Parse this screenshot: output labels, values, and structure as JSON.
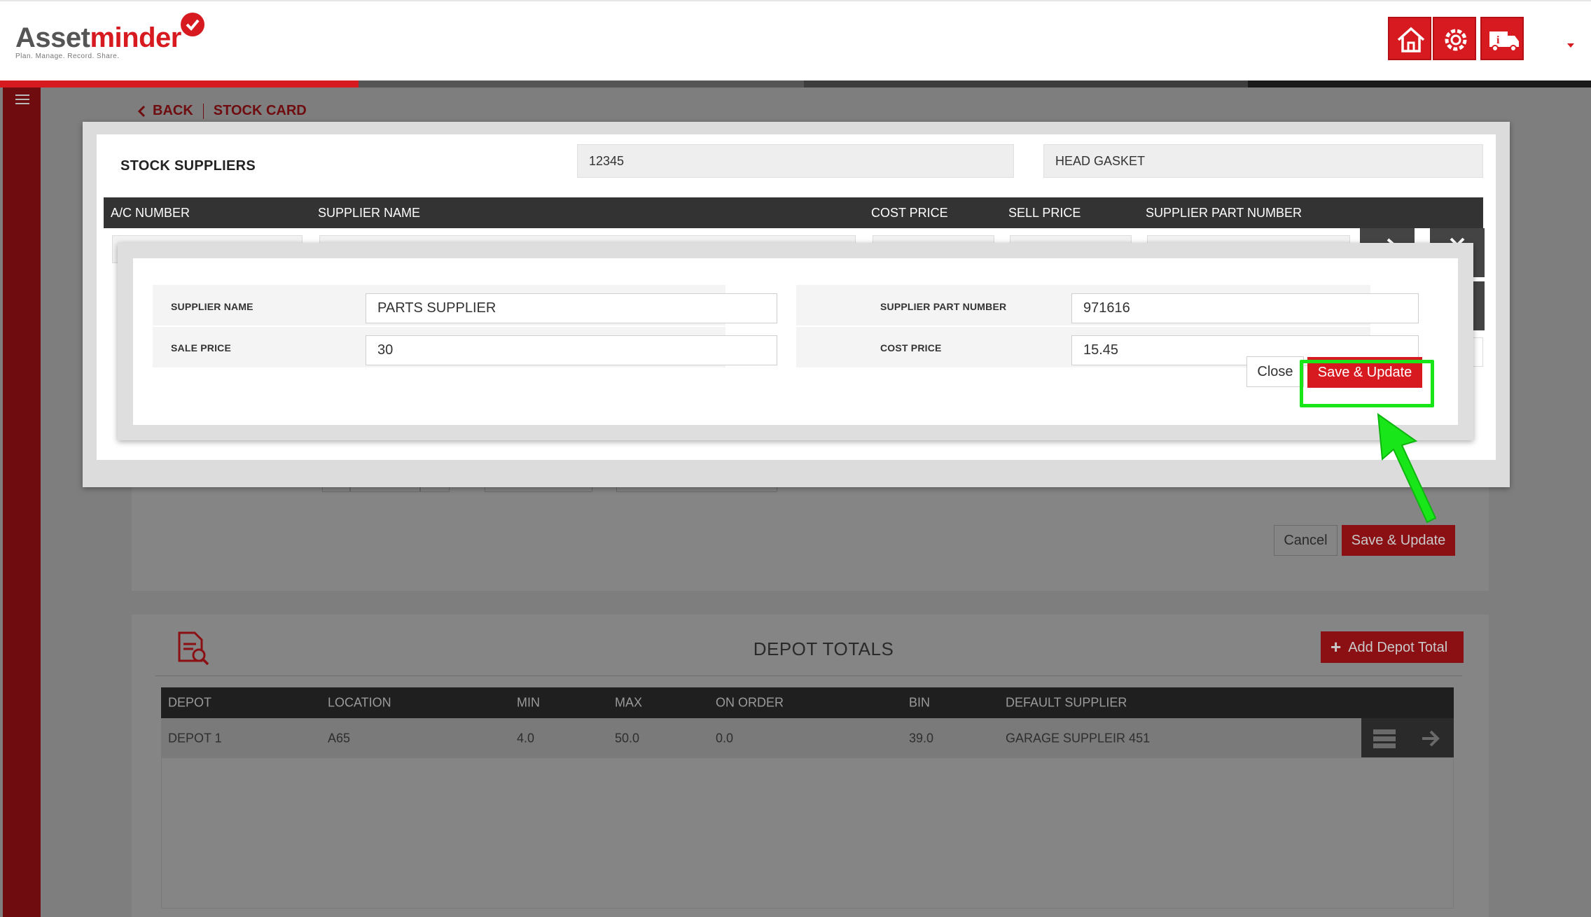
{
  "header": {
    "logo_prefix": "Asset",
    "logo_suffix": "minder",
    "logo_tagline": "Plan. Manage. Record. Share.",
    "buttons": [
      "home-icon",
      "service-gear-icon",
      "vehicle-info-icon"
    ],
    "accent": "#d71920"
  },
  "breadcrumb": {
    "back_label": "BACK",
    "current_label": "STOCK CARD"
  },
  "stock_suppliers_modal": {
    "title": "STOCK SUPPLIERS",
    "part_code": "12345",
    "part_name": "HEAD GASKET",
    "columns": [
      "A/C NUMBER",
      "SUPPLIER NAME",
      "COST PRICE",
      "SELL PRICE",
      "SUPPLIER PART NUMBER"
    ]
  },
  "edit_supplier_form": {
    "supplier_name_label": "SUPPLIER NAME",
    "supplier_name_value": "PARTS SUPPLIER",
    "supplier_part_number_label": "SUPPLIER PART NUMBER",
    "supplier_part_number_value": "971616",
    "sale_price_label": "SALE PRICE",
    "sale_price_value": "30",
    "cost_price_label": "COST PRICE",
    "cost_price_value": "15.45",
    "close_label": "Close",
    "save_label": "Save & Update"
  },
  "background_form": {
    "cancel_label": "Cancel",
    "save_label": "Save & Update"
  },
  "depot_totals": {
    "title": "DEPOT TOTALS",
    "add_label": "Add Depot Total",
    "columns": [
      "DEPOT",
      "LOCATION",
      "MIN",
      "MAX",
      "ON ORDER",
      "BIN",
      "DEFAULT SUPPLIER"
    ],
    "rows": [
      {
        "depot": "DEPOT 1",
        "location": "A65",
        "min": "4.0",
        "max": "50.0",
        "on_order": "0.0",
        "bin": "39.0",
        "default_supplier": "GARAGE SUPPLEIR 451"
      }
    ]
  },
  "annotation": {
    "highlight_color": "#19e619"
  }
}
